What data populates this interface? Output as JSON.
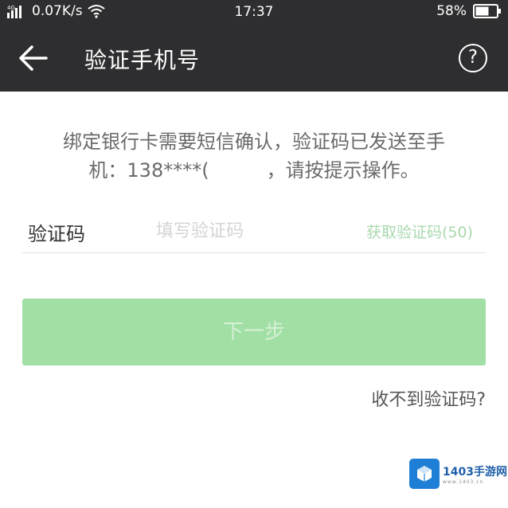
{
  "status_bar": {
    "network_speed": "0.07K/s",
    "time": "17:37",
    "battery": "58%"
  },
  "nav": {
    "title": "验证手机号",
    "help_symbol": "?"
  },
  "notice": {
    "line1": "绑定银行卡需要短信确认，验证码已发送至手",
    "prefix": "机：",
    "masked_phone": "138****(",
    "suffix": "，请按提示操作。"
  },
  "code_row": {
    "label": "验证码",
    "placeholder": "填写验证码",
    "get_code": "获取验证码(50)"
  },
  "next_button": {
    "label": "下一步"
  },
  "help_link": {
    "label": "收不到验证码?"
  },
  "watermark": {
    "title": "1403手游网",
    "subtitle": "www.1403.cn"
  },
  "colors": {
    "bar_bg": "#2e2e30",
    "button_green": "#a2dfa4",
    "link_green": "#a9d9ad"
  },
  "icons": [
    "signal-icon",
    "wifi-icon",
    "battery-icon",
    "back-arrow-icon",
    "help-icon",
    "watermark-logo-icon"
  ]
}
